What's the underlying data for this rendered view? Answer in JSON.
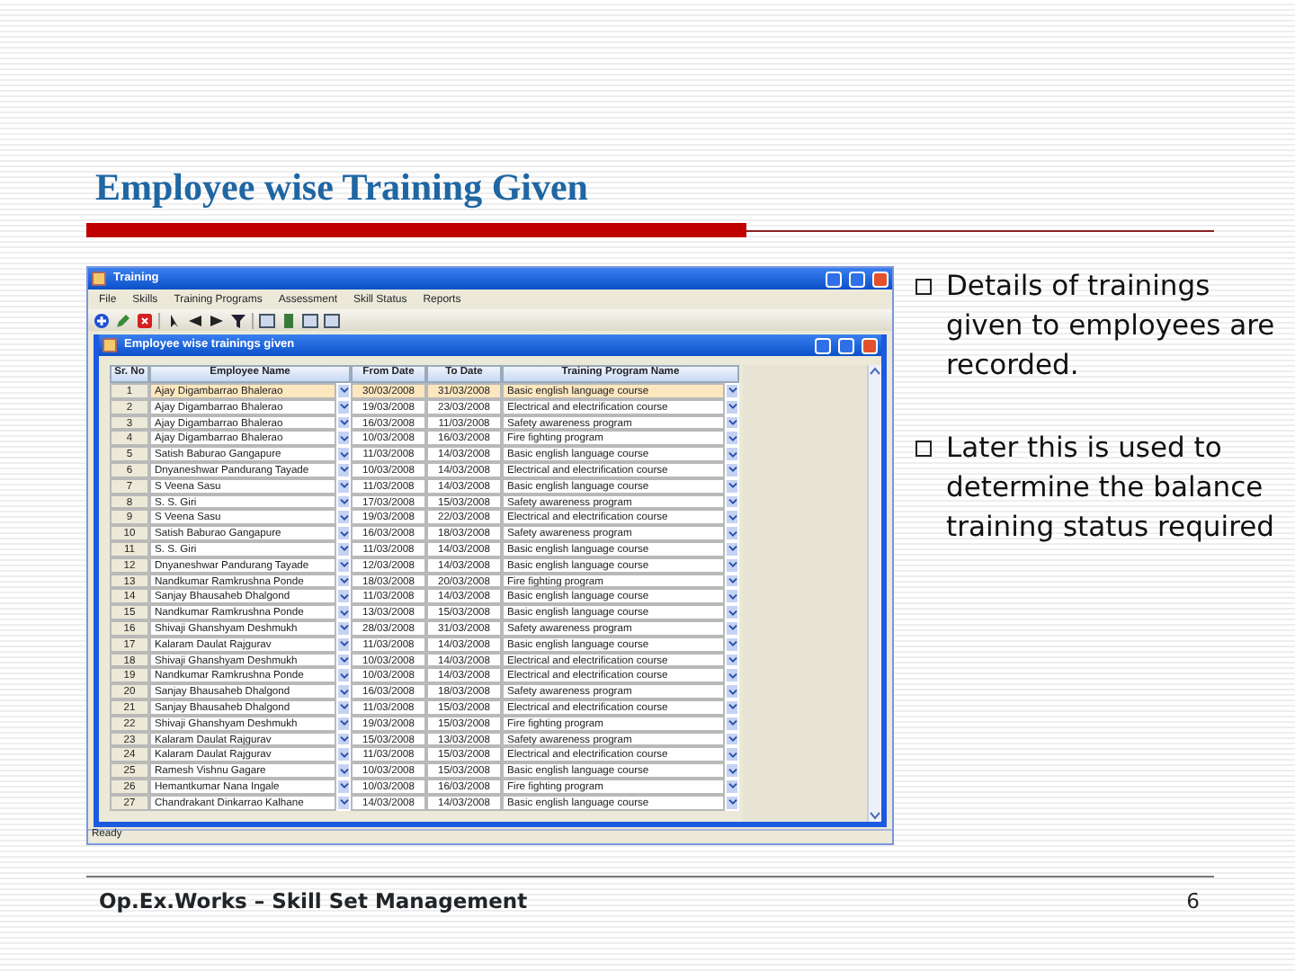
{
  "slide": {
    "title": "Employee wise Training Given",
    "bullets": [
      "Details of trainings given to employees are recorded.",
      "Later this is used to determine the balance training status required"
    ],
    "footer": "Op.Ex.Works – Skill Set Management",
    "page_number": "6"
  },
  "app": {
    "window": {
      "title": "Training"
    },
    "menu": [
      "File",
      "Skills",
      "Training Programs",
      "Assessment",
      "Skill Status",
      "Reports"
    ],
    "child_window": {
      "title": "Employee wise trainings given"
    },
    "table": {
      "columns": [
        "Sr. No",
        "Employee Name",
        "From Date",
        "To Date",
        "Training Program Name"
      ],
      "rows": [
        {
          "sr_no": "1",
          "employee_name": "Ajay Digambarrao Bhalerao",
          "from_date": "30/03/2008",
          "to_date": "31/03/2008",
          "training_program": "Basic english language course",
          "selected": true
        },
        {
          "sr_no": "2",
          "employee_name": "Ajay Digambarrao Bhalerao",
          "from_date": "19/03/2008",
          "to_date": "23/03/2008",
          "training_program": "Electrical and electrification course",
          "selected": false
        },
        {
          "sr_no": "3",
          "employee_name": "Ajay Digambarrao Bhalerao",
          "from_date": "16/03/2008",
          "to_date": "11/03/2008",
          "training_program": "Safety awareness program",
          "selected": false
        },
        {
          "sr_no": "4",
          "employee_name": "Ajay Digambarrao Bhalerao",
          "from_date": "10/03/2008",
          "to_date": "16/03/2008",
          "training_program": "Fire fighting program",
          "selected": false
        },
        {
          "sr_no": "5",
          "employee_name": "Satish Baburao Gangapure",
          "from_date": "11/03/2008",
          "to_date": "14/03/2008",
          "training_program": "Basic english language course",
          "selected": false
        },
        {
          "sr_no": "6",
          "employee_name": "Dnyaneshwar Pandurang Tayade",
          "from_date": "10/03/2008",
          "to_date": "14/03/2008",
          "training_program": "Electrical and electrification course",
          "selected": false
        },
        {
          "sr_no": "7",
          "employee_name": "S Veena Sasu",
          "from_date": "11/03/2008",
          "to_date": "14/03/2008",
          "training_program": "Basic english language course",
          "selected": false
        },
        {
          "sr_no": "8",
          "employee_name": "S. S. Giri",
          "from_date": "17/03/2008",
          "to_date": "15/03/2008",
          "training_program": "Safety awareness program",
          "selected": false
        },
        {
          "sr_no": "9",
          "employee_name": "S Veena Sasu",
          "from_date": "19/03/2008",
          "to_date": "22/03/2008",
          "training_program": "Electrical and electrification course",
          "selected": false
        },
        {
          "sr_no": "10",
          "employee_name": "Satish Baburao Gangapure",
          "from_date": "16/03/2008",
          "to_date": "18/03/2008",
          "training_program": "Safety awareness program",
          "selected": false
        },
        {
          "sr_no": "11",
          "employee_name": "S. S. Giri",
          "from_date": "11/03/2008",
          "to_date": "14/03/2008",
          "training_program": "Basic english language course",
          "selected": false
        },
        {
          "sr_no": "12",
          "employee_name": "Dnyaneshwar Pandurang Tayade",
          "from_date": "12/03/2008",
          "to_date": "14/03/2008",
          "training_program": "Basic english language course",
          "selected": false
        },
        {
          "sr_no": "13",
          "employee_name": "Nandkumar Ramkrushna Ponde",
          "from_date": "18/03/2008",
          "to_date": "20/03/2008",
          "training_program": "Fire fighting program",
          "selected": false
        },
        {
          "sr_no": "14",
          "employee_name": "Sanjay Bhausaheb Dhalgond",
          "from_date": "11/03/2008",
          "to_date": "14/03/2008",
          "training_program": "Basic english language course",
          "selected": false
        },
        {
          "sr_no": "15",
          "employee_name": "Nandkumar Ramkrushna Ponde",
          "from_date": "13/03/2008",
          "to_date": "15/03/2008",
          "training_program": "Basic english language course",
          "selected": false
        },
        {
          "sr_no": "16",
          "employee_name": "Shivaji Ghanshyam Deshmukh",
          "from_date": "28/03/2008",
          "to_date": "31/03/2008",
          "training_program": "Safety awareness program",
          "selected": false
        },
        {
          "sr_no": "17",
          "employee_name": "Kalaram Daulat Rajgurav",
          "from_date": "11/03/2008",
          "to_date": "14/03/2008",
          "training_program": "Basic english language course",
          "selected": false
        },
        {
          "sr_no": "18",
          "employee_name": "Shivaji Ghanshyam Deshmukh",
          "from_date": "10/03/2008",
          "to_date": "14/03/2008",
          "training_program": "Electrical and electrification course",
          "selected": false
        },
        {
          "sr_no": "19",
          "employee_name": "Nandkumar Ramkrushna Ponde",
          "from_date": "10/03/2008",
          "to_date": "14/03/2008",
          "training_program": "Electrical and electrification course",
          "selected": false
        },
        {
          "sr_no": "20",
          "employee_name": "Sanjay Bhausaheb Dhalgond",
          "from_date": "16/03/2008",
          "to_date": "18/03/2008",
          "training_program": "Safety awareness program",
          "selected": false
        },
        {
          "sr_no": "21",
          "employee_name": "Sanjay Bhausaheb Dhalgond",
          "from_date": "11/03/2008",
          "to_date": "15/03/2008",
          "training_program": "Electrical and electrification course",
          "selected": false
        },
        {
          "sr_no": "22",
          "employee_name": "Shivaji Ghanshyam Deshmukh",
          "from_date": "19/03/2008",
          "to_date": "15/03/2008",
          "training_program": "Fire fighting program",
          "selected": false
        },
        {
          "sr_no": "23",
          "employee_name": "Kalaram Daulat Rajgurav",
          "from_date": "15/03/2008",
          "to_date": "13/03/2008",
          "training_program": "Safety awareness program",
          "selected": false
        },
        {
          "sr_no": "24",
          "employee_name": "Kalaram Daulat Rajgurav",
          "from_date": "11/03/2008",
          "to_date": "15/03/2008",
          "training_program": "Electrical and electrification course",
          "selected": false
        },
        {
          "sr_no": "25",
          "employee_name": "Ramesh Vishnu Gagare",
          "from_date": "10/03/2008",
          "to_date": "15/03/2008",
          "training_program": "Basic english language course",
          "selected": false
        },
        {
          "sr_no": "26",
          "employee_name": "Hemantkumar Nana Ingale",
          "from_date": "10/03/2008",
          "to_date": "16/03/2008",
          "training_program": "Fire fighting program",
          "selected": false
        },
        {
          "sr_no": "27",
          "employee_name": "Chandrakant Dinkarrao Kalhane",
          "from_date": "14/03/2008",
          "to_date": "14/03/2008",
          "training_program": "Basic english language course",
          "selected": false
        }
      ]
    },
    "status_bar": "Ready"
  }
}
